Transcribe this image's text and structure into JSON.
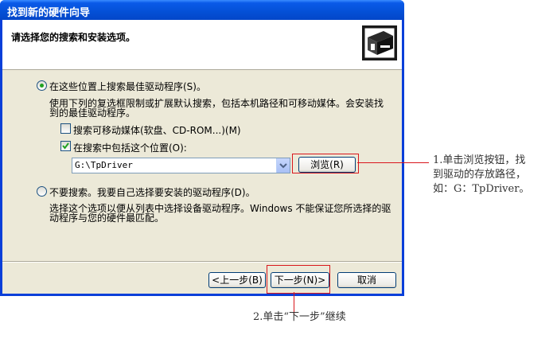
{
  "window": {
    "title": "找到新的硬件向导"
  },
  "header": {
    "title": "请选择您的搜索和安装选项。"
  },
  "search_option": {
    "label": "在这些位置上搜索最佳驱动程序(S)。",
    "description_line1": "使用下列的复选框限制或扩展默认搜索，包括本机路径和可移动媒体。会安装找",
    "description_line2": "到的最佳驱动程序。",
    "removable_media_label": "搜索可移动媒体(软盘、CD-ROM...)(M)",
    "removable_media_checked": false,
    "include_location_label": "在搜索中包括这个位置(O):",
    "include_location_checked": true,
    "location_value": "G:\\TpDriver",
    "browse_label": "浏览(R)"
  },
  "no_search_option": {
    "label": "不要搜索。我要自己选择要安装的驱动程序(D)。",
    "description_line1": "选择这个选项以便从列表中选择设备驱动程序。Windows 不能保证您所选择的驱",
    "description_line2": "动程序与您的硬件最匹配。"
  },
  "footer": {
    "back_label": "<上一步(B)",
    "next_label": "下一步(N)>",
    "cancel_label": "取消"
  },
  "annotations": {
    "step1_line1": "1.单击浏览按钮，找",
    "step1_line2": "到驱动的存放路径，",
    "step1_line3": "如：G：TpDriver。",
    "step2": "2.单击“下一步”继续"
  },
  "colors": {
    "titlebar": "#0450d6",
    "dialog_bg": "#ece9d8",
    "highlight": "#d9161c"
  }
}
